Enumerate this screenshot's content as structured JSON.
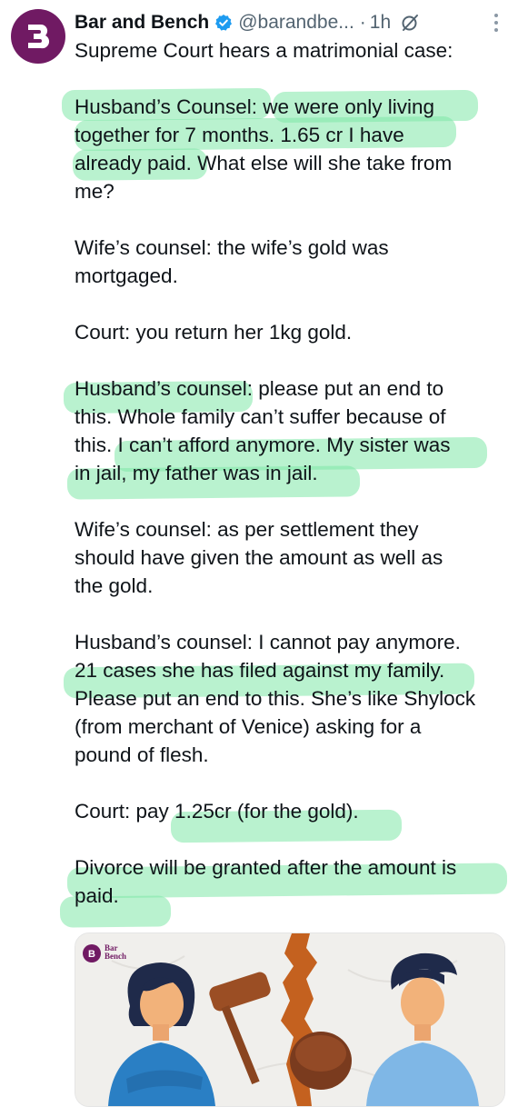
{
  "author": {
    "name": "Bar and Bench",
    "handle": "@barandbe...",
    "separator": "·",
    "time": "1h",
    "avatar_glyph": "B",
    "avatar_color": "#701a63",
    "verified_color": "#1d9bf0"
  },
  "tweet": {
    "lines": [
      "Supreme Court hears a matrimonial case:",
      "",
      "Husband’s Counsel: we were only living",
      "together for 7 months. 1.65 cr I have",
      "already paid. What else will she take from",
      "me?",
      "",
      "Wife’s counsel: the wife’s gold was",
      "mortgaged.",
      "",
      "Court: you return her 1kg gold.",
      "",
      "Husband’s counsel: please put an end to",
      "this. Whole family can’t suffer because of",
      "this. I can’t afford anymore. My sister was",
      "in jail, my father was in jail.",
      "",
      "Wife’s counsel: as per settlement they",
      "should have given the amount as well as",
      "the gold.",
      "",
      "Husband’s counsel: I cannot pay anymore.",
      "21 cases she has filed against my family.",
      "Please put an end to this. She’s like Shylock",
      "(from merchant of Venice) asking for a",
      "pound of flesh.",
      "",
      "Court: pay 1.25cr (for the gold).",
      "",
      "Divorce will be granted after the amount is",
      "paid."
    ]
  },
  "card": {
    "logo_line1": "Bar",
    "logo_line2": "Bench",
    "logo_glyph": "B",
    "highlight_color": "#80e8a8"
  }
}
